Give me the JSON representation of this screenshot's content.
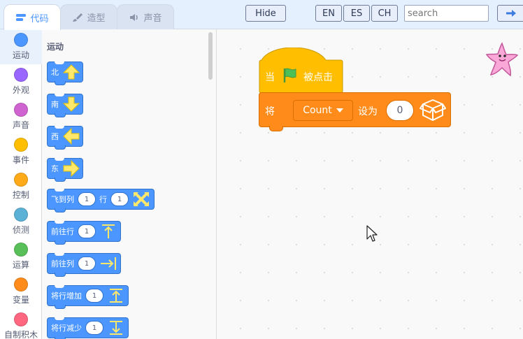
{
  "tabs": [
    {
      "label": "代码",
      "icon": "code-icon",
      "active": true
    },
    {
      "label": "造型",
      "icon": "brush-icon",
      "active": false
    },
    {
      "label": "声音",
      "icon": "speaker-icon",
      "active": false
    }
  ],
  "toolbar": {
    "hide_label": "Hide",
    "lang_en": "EN",
    "lang_es": "ES",
    "lang_ch": "CH",
    "search_placeholder": "search",
    "go_icon": "arrow-right-icon"
  },
  "categories": [
    {
      "label": "运动",
      "color": "#4c97ff",
      "selected": true
    },
    {
      "label": "外观",
      "color": "#9966ff",
      "selected": false
    },
    {
      "label": "声音",
      "color": "#cf63cf",
      "selected": false
    },
    {
      "label": "事件",
      "color": "#ffbf00",
      "selected": false
    },
    {
      "label": "控制",
      "color": "#ffab19",
      "selected": false
    },
    {
      "label": "侦测",
      "color": "#5cb1d6",
      "selected": false
    },
    {
      "label": "运算",
      "color": "#59c059",
      "selected": false
    },
    {
      "label": "变量",
      "color": "#ff8c1a",
      "selected": false
    },
    {
      "label": "自制积木",
      "color": "#ff6680",
      "selected": false
    }
  ],
  "palette": {
    "title": "运动",
    "blocks": [
      {
        "label": "北",
        "icon": "arrow-up-icon"
      },
      {
        "label": "南",
        "icon": "arrow-down-icon"
      },
      {
        "label": "西",
        "icon": "arrow-left-icon"
      },
      {
        "label": "东",
        "icon": "arrow-right-icon"
      },
      {
        "label": "飞到列",
        "value1": "1",
        "label2": "行",
        "value2": "1",
        "icon": "cross-arrows-icon"
      },
      {
        "label": "前往行",
        "value1": "1",
        "icon": "arrow-up-bar-icon"
      },
      {
        "label": "前往列",
        "value1": "1",
        "icon": "arrow-right-bar-icon"
      },
      {
        "label": "将行增加",
        "value1": "1",
        "icon": "arrow-up-bar-icon"
      },
      {
        "label": "将行减少",
        "value1": "1",
        "icon": "arrow-down-bar-icon"
      }
    ]
  },
  "workspace": {
    "hat_block": {
      "prefix": "当",
      "icon": "green-flag-icon",
      "suffix": "被点击",
      "color": "#ffbf00"
    },
    "set_block": {
      "prefix": "将",
      "variable": "Count",
      "middle": "设为",
      "value": "0",
      "icon": "box-icon",
      "color": "#ff8c1a"
    },
    "sprite_icon": "starfish-sprite-icon"
  }
}
